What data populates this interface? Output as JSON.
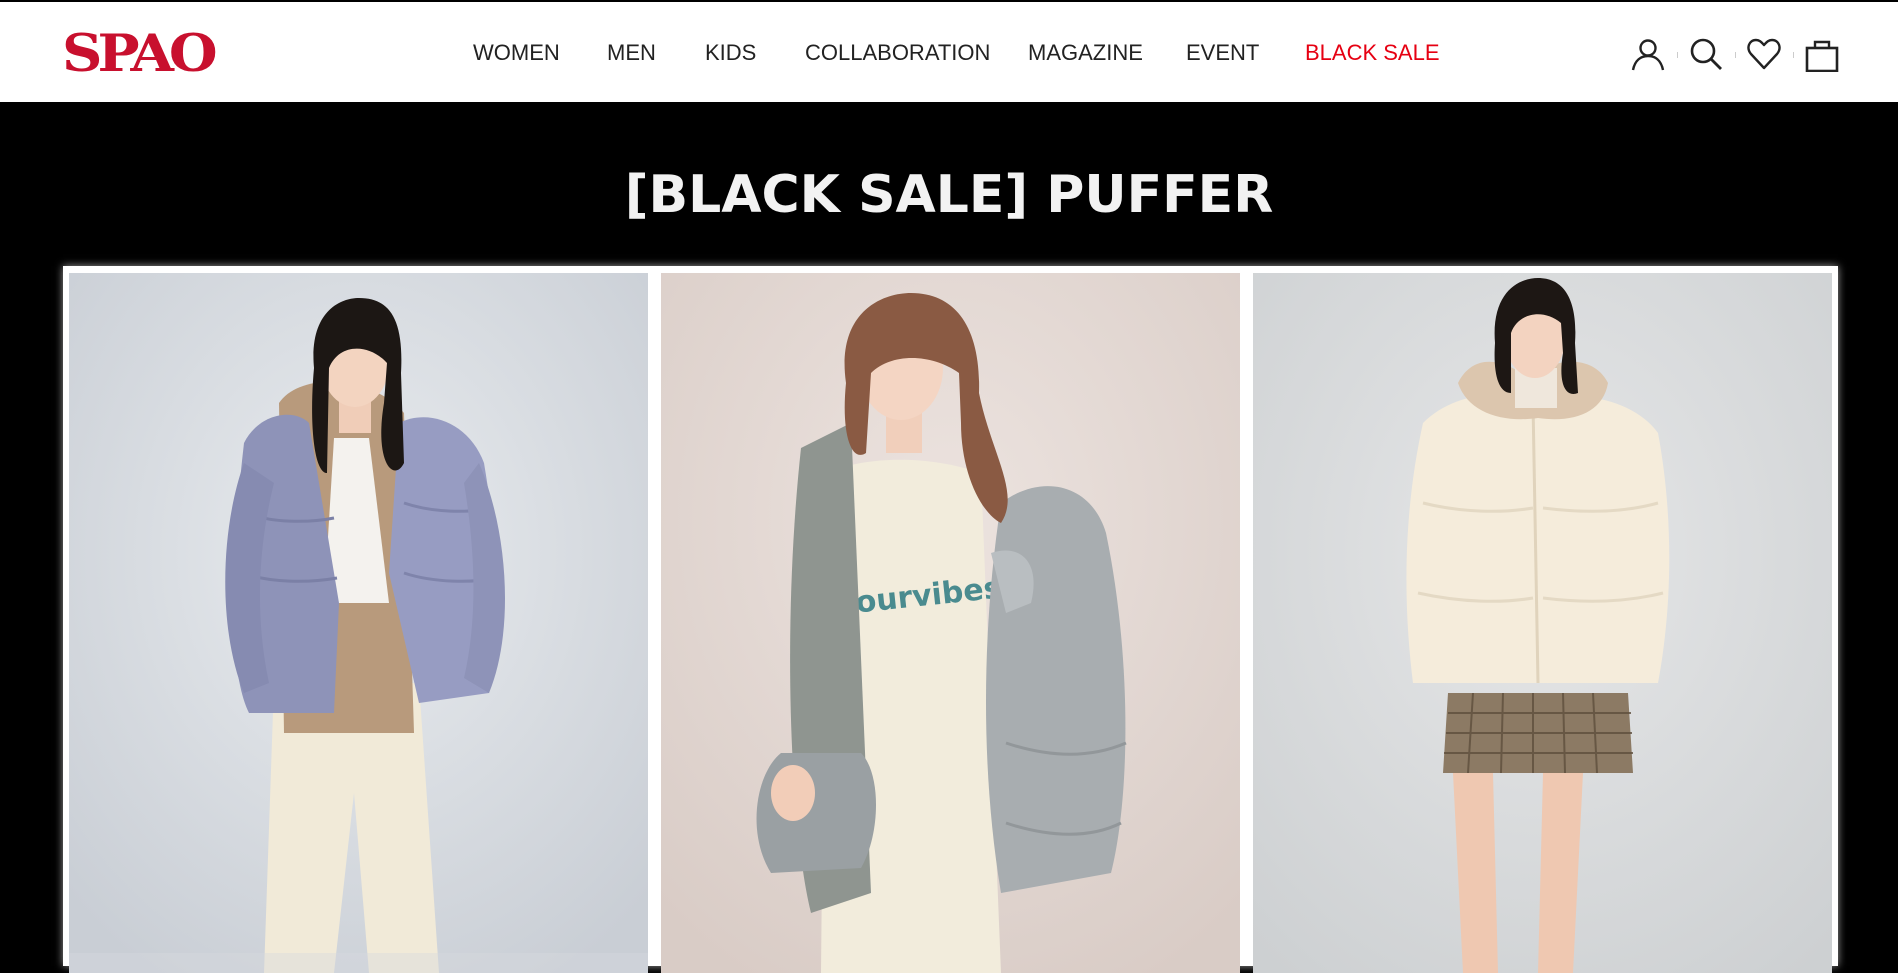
{
  "brand": {
    "logo_text": "SPAO",
    "logo_color": "#c8102e"
  },
  "nav": {
    "items": [
      {
        "label": "WOMEN"
      },
      {
        "label": "MEN"
      },
      {
        "label": "KIDS"
      },
      {
        "label": "COLLABORATION"
      },
      {
        "label": "MAGAZINE"
      },
      {
        "label": "EVENT"
      },
      {
        "label": "BLACK SALE",
        "highlight_color": "#e60012"
      }
    ]
  },
  "utility_icons": [
    "user-icon",
    "search-icon",
    "heart-icon",
    "shopping-bag-icon"
  ],
  "hero": {
    "title": "[BLACK SALE] PUFFER"
  },
  "gallery": {
    "products": [
      {
        "image": "model-in-lavender-puffer-jacket"
      },
      {
        "image": "model-in-gray-puffer-jacket",
        "sweatshirt_text": "ourvibes"
      },
      {
        "image": "model-in-cream-puffer-jacket-with-fur-collar"
      }
    ]
  }
}
